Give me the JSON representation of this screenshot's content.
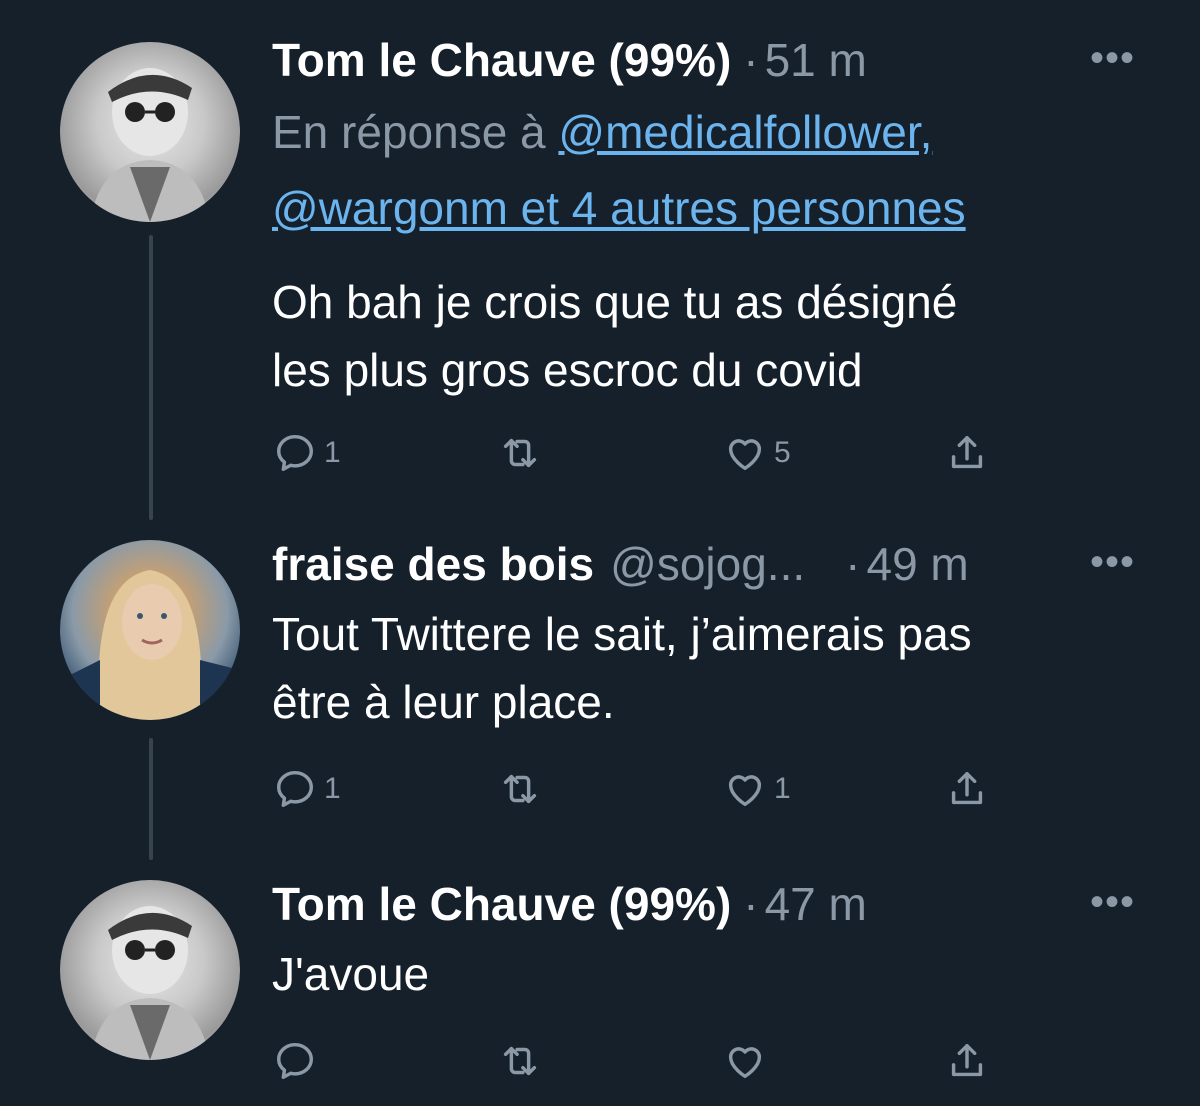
{
  "tweets": [
    {
      "name": "Tom le Chauve (99%)",
      "handle": "",
      "separator": "·",
      "time": "51 m",
      "more": "•••",
      "reply_prefix": "En réponse à ",
      "reply_link_1": "@medicalfollower,",
      "reply_link_2": "@wargonm et 4 autres personnes",
      "text_lines": [
        "Oh bah je crois que tu as désigné",
        "les plus gros escroc du covid"
      ],
      "replies": "1",
      "retweets": "",
      "likes": "5"
    },
    {
      "name": "fraise des bois",
      "handle": "@sojog...",
      "separator": "·",
      "time": "49 m",
      "more": "•••",
      "text_lines": [
        "Tout Twittere le sait, j’aimerais pas",
        "être à leur place."
      ],
      "replies": "1",
      "retweets": "",
      "likes": "1"
    },
    {
      "name": "Tom le Chauve (99%)",
      "handle": "",
      "separator": "·",
      "time": "47 m",
      "more": "•••",
      "text_lines": [
        "J'avoue"
      ],
      "replies": "",
      "retweets": "",
      "likes": ""
    }
  ],
  "icons": {
    "reply": "reply-icon",
    "retweet": "retweet-icon",
    "like": "heart-icon",
    "share": "share-icon"
  },
  "colors": {
    "background": "#15202b",
    "text": "#ffffff",
    "secondary": "#8b98a5",
    "link": "#6cb4ee",
    "thread_line": "#38444d"
  }
}
